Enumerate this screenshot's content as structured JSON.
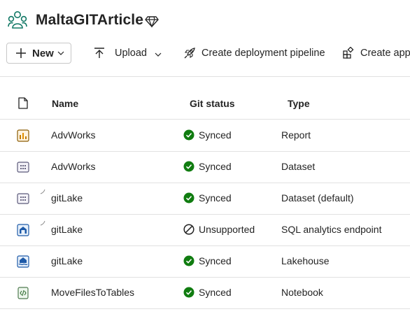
{
  "workspace": {
    "title": "MaltaGITArticle",
    "icon": "workspace-people-icon",
    "badge_icon": "premium-diamond-icon"
  },
  "toolbar": {
    "new_label": "New",
    "upload_label": "Upload",
    "pipeline_label": "Create deployment pipeline",
    "app_label": "Create app"
  },
  "table": {
    "headers": {
      "name": "Name",
      "git_status": "Git status",
      "type": "Type"
    },
    "rows": [
      {
        "name": "AdvWorks",
        "icon": "report-icon",
        "git_status": "Synced",
        "type": "Report"
      },
      {
        "name": "AdvWorks",
        "icon": "dataset-icon",
        "git_status": "Synced",
        "type": "Dataset"
      },
      {
        "name": "gitLake",
        "icon": "dataset-icon",
        "git_status": "Synced",
        "type": "Dataset (default)"
      },
      {
        "name": "gitLake",
        "icon": "sql-endpoint-icon",
        "git_status": "Unsupported",
        "type": "SQL analytics endpoint"
      },
      {
        "name": "gitLake",
        "icon": "lakehouse-icon",
        "git_status": "Synced",
        "type": "Lakehouse"
      },
      {
        "name": "MoveFilesToTables",
        "icon": "notebook-icon",
        "git_status": "Synced",
        "type": "Notebook"
      }
    ]
  },
  "colors": {
    "synced": "#107c10",
    "accent": "#117865",
    "text": "#242424"
  }
}
